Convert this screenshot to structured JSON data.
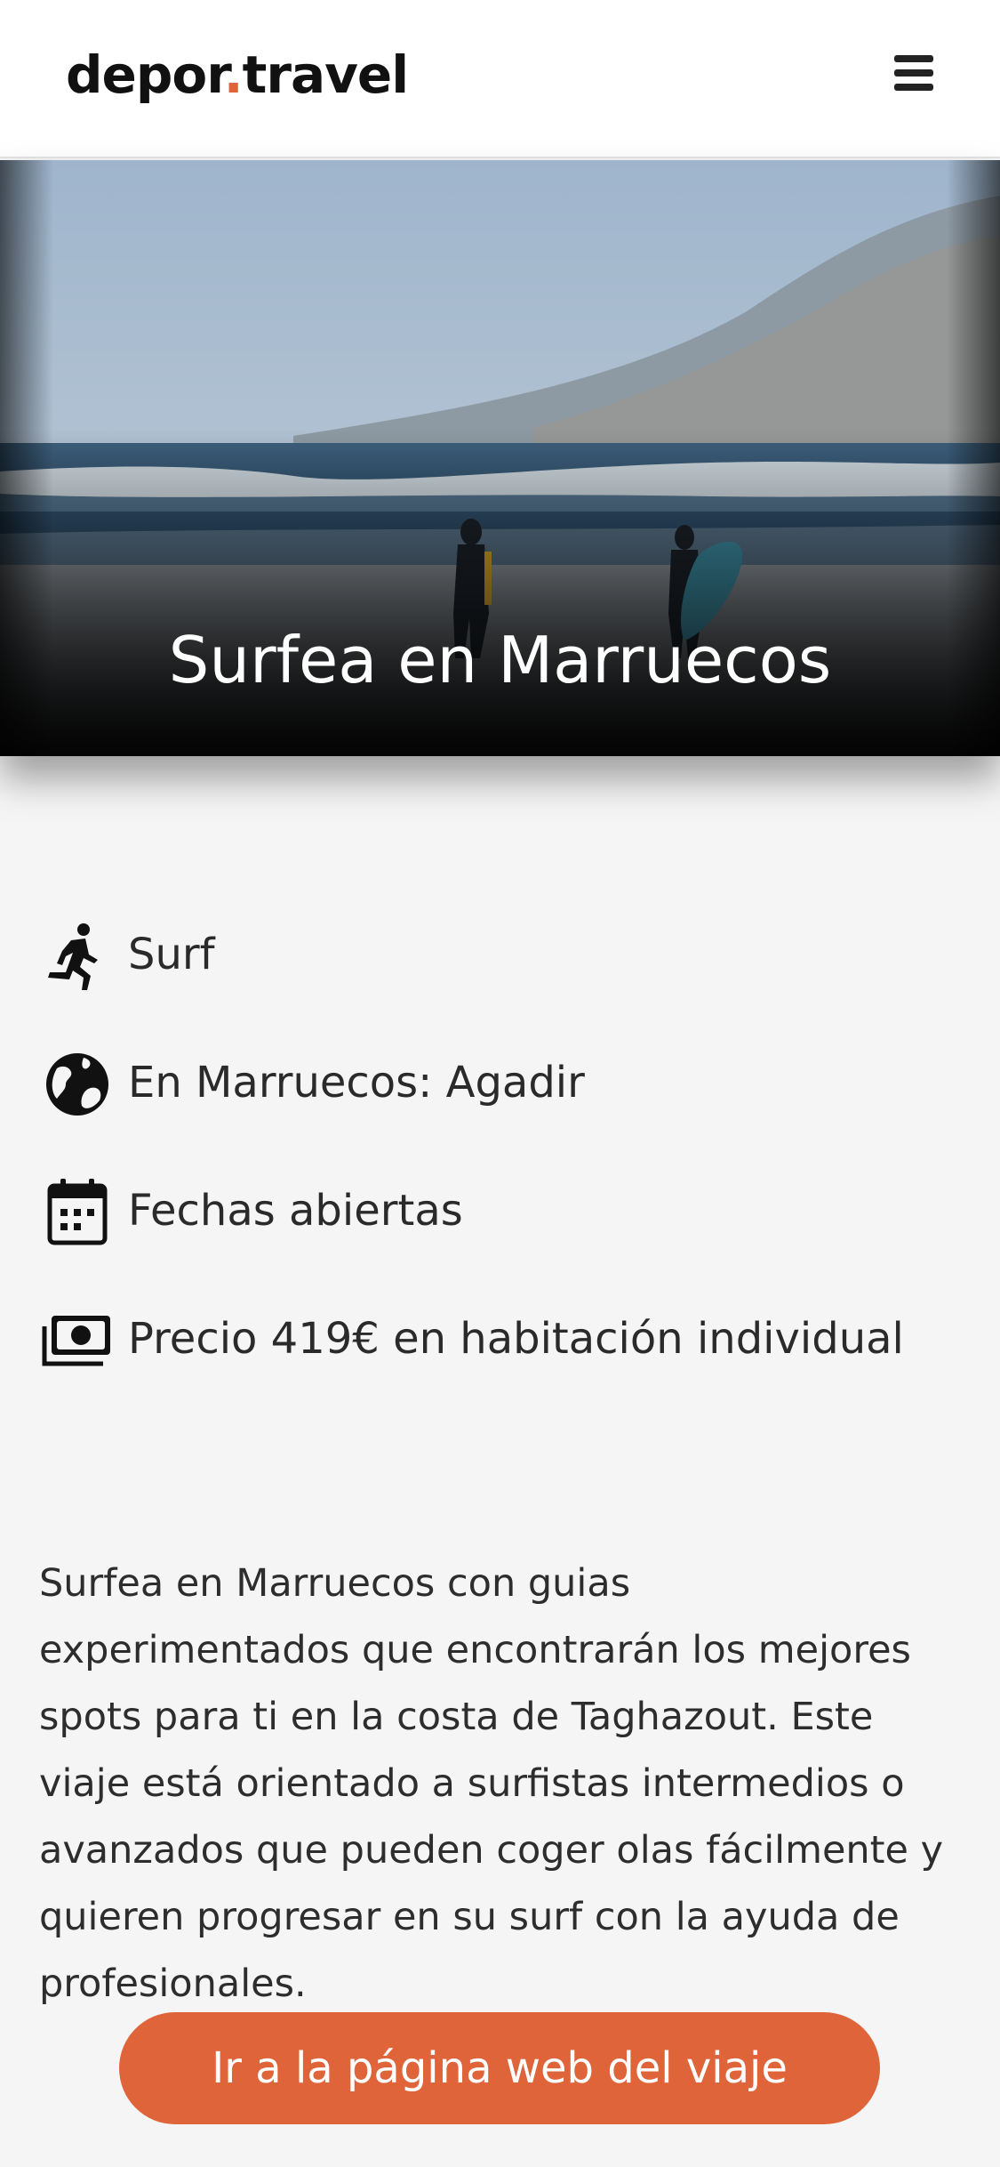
{
  "header": {
    "logo_left": "depor",
    "logo_dot": ".",
    "logo_right": "travel",
    "menu_icon": "hamburger-menu-icon"
  },
  "hero": {
    "title": "Surfea en Marruecos"
  },
  "details": [
    {
      "icon": "running-person-icon",
      "text": "Surf"
    },
    {
      "icon": "globe-icon",
      "text": "En Marruecos: Agadir"
    },
    {
      "icon": "calendar-icon",
      "text": "Fechas abiertas"
    },
    {
      "icon": "money-bill-icon",
      "text": "Precio 419€ en habitación individual"
    }
  ],
  "description": "Surfea en Marruecos con guias experimentados que encontrarán los mejores spots para ti en la costa de Taghazout. Este viaje está orientado a surfistas intermedios o avanzados que pueden coger olas fácilmente y quieren progresar en su surf con la ayuda de profesionales.",
  "cta": {
    "label": "Ir a la página web del viaje"
  },
  "colors": {
    "accent": "#e0643a",
    "background": "#f5f5f5",
    "header_bg": "#ffffff"
  }
}
